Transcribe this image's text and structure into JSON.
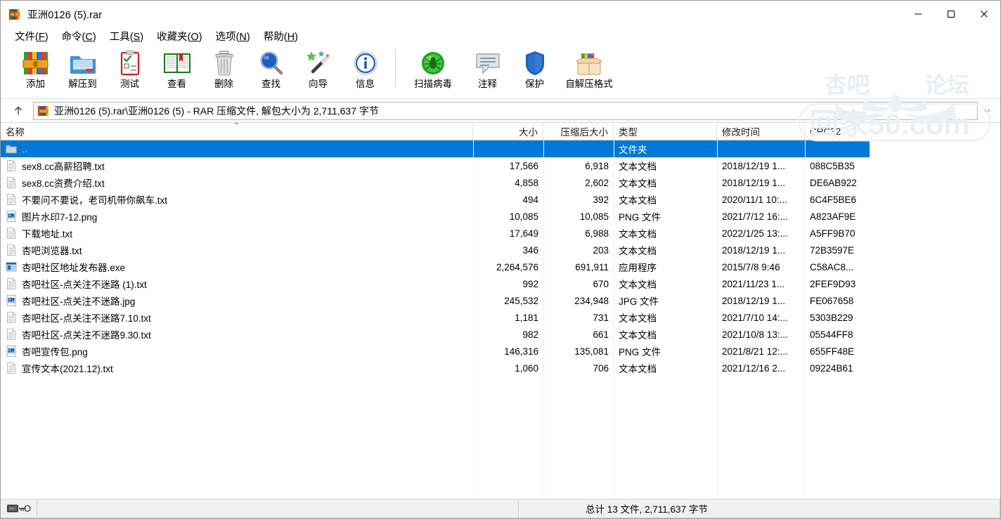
{
  "window": {
    "title": "亚洲0126 (5).rar",
    "icon": "rar-archive-icon",
    "minimize_label": "—",
    "maximize_label": "□",
    "close_label": "✕"
  },
  "menubar": [
    {
      "text": "文件",
      "accel": "F"
    },
    {
      "text": "命令",
      "accel": "C"
    },
    {
      "text": "工具",
      "accel": "S"
    },
    {
      "text": "收藏夹",
      "accel": "O"
    },
    {
      "text": "选项",
      "accel": "N"
    },
    {
      "text": "帮助",
      "accel": "H"
    }
  ],
  "toolbar": {
    "buttons": [
      {
        "label": "添加",
        "icon": "add-archive-icon"
      },
      {
        "label": "解压到",
        "icon": "extract-to-folder-icon"
      },
      {
        "label": "测试",
        "icon": "test-clipboard-icon"
      },
      {
        "label": "查看",
        "icon": "view-book-icon"
      },
      {
        "label": "删除",
        "icon": "delete-trash-icon"
      },
      {
        "label": "查找",
        "icon": "find-magnifier-icon"
      },
      {
        "label": "向导",
        "icon": "wizard-wand-icon"
      },
      {
        "label": "信息",
        "icon": "info-circle-icon"
      }
    ],
    "buttons2": [
      {
        "label": "扫描病毒",
        "icon": "virus-scan-icon"
      },
      {
        "label": "注释",
        "icon": "comment-bubble-icon"
      },
      {
        "label": "保护",
        "icon": "protect-shield-icon"
      },
      {
        "label": "自解压格式",
        "icon": "sfx-box-icon"
      }
    ]
  },
  "watermark": {
    "top_left": "杏吧",
    "top_right": "论坛",
    "bottom": "回家50.com",
    "color": "#eceff1"
  },
  "addressbar": {
    "up_icon": "arrow-up-icon",
    "archive_icon": "rar-archive-icon",
    "path": "亚洲0126 (5).rar\\亚洲0126 (5) - RAR 压缩文件, 解包大小为 2,711,637 字节",
    "dropdown_icon": "chevron-down-icon"
  },
  "columns": [
    {
      "key": "name",
      "label": "名称",
      "align": "left",
      "sorted": true
    },
    {
      "key": "size",
      "label": "大小",
      "align": "right",
      "sorted": false
    },
    {
      "key": "pack",
      "label": "压缩后大小",
      "align": "right",
      "sorted": false
    },
    {
      "key": "type",
      "label": "类型",
      "align": "left",
      "sorted": false
    },
    {
      "key": "date",
      "label": "修改时间",
      "align": "left",
      "sorted": false
    },
    {
      "key": "crc",
      "label": "CRC32",
      "align": "left",
      "sorted": false
    }
  ],
  "rows": [
    {
      "name": "..",
      "icon": "folder-icon",
      "size": "",
      "pack": "",
      "type": "文件夹",
      "date": "",
      "crc": "",
      "selected": true
    },
    {
      "name": "sex8.cc高薪招聘.txt",
      "icon": "text-file-icon",
      "size": "17,566",
      "pack": "6,918",
      "type": "文本文档",
      "date": "2018/12/19 1...",
      "crc": "088C5B35",
      "selected": false
    },
    {
      "name": "sex8.cc资费介绍.txt",
      "icon": "text-file-icon",
      "size": "4,858",
      "pack": "2,602",
      "type": "文本文档",
      "date": "2018/12/19 1...",
      "crc": "DE6AB922",
      "selected": false
    },
    {
      "name": "不要问不要说，老司机带你飙车.txt",
      "icon": "text-file-icon",
      "size": "494",
      "pack": "392",
      "type": "文本文档",
      "date": "2020/11/1 10:...",
      "crc": "6C4F5BE6",
      "selected": false
    },
    {
      "name": "图片水印7-12.png",
      "icon": "image-file-icon",
      "size": "10,085",
      "pack": "10,085",
      "type": "PNG 文件",
      "date": "2021/7/12 16:...",
      "crc": "A823AF9E",
      "selected": false
    },
    {
      "name": "下载地址.txt",
      "icon": "text-file-icon",
      "size": "17,649",
      "pack": "6,988",
      "type": "文本文档",
      "date": "2022/1/25 13:...",
      "crc": "A5FF9B70",
      "selected": false
    },
    {
      "name": "杏吧浏览器.txt",
      "icon": "text-file-icon",
      "size": "346",
      "pack": "203",
      "type": "文本文档",
      "date": "2018/12/19 1...",
      "crc": "72B3597E",
      "selected": false
    },
    {
      "name": "杏吧社区地址发布器.exe",
      "icon": "exe-file-icon",
      "size": "2,264,576",
      "pack": "691,911",
      "type": "应用程序",
      "date": "2015/7/8 9:46",
      "crc": "C58AC8...",
      "selected": false
    },
    {
      "name": "杏吧社区-点关注不迷路 (1).txt",
      "icon": "text-file-icon",
      "size": "992",
      "pack": "670",
      "type": "文本文档",
      "date": "2021/11/23 1...",
      "crc": "2FEF9D93",
      "selected": false
    },
    {
      "name": "杏吧社区-点关注不迷路.jpg",
      "icon": "image-file-icon",
      "size": "245,532",
      "pack": "234,948",
      "type": "JPG 文件",
      "date": "2018/12/19 1...",
      "crc": "FE067658",
      "selected": false
    },
    {
      "name": "杏吧社区-点关注不迷路7.10.txt",
      "icon": "text-file-icon",
      "size": "1,181",
      "pack": "731",
      "type": "文本文档",
      "date": "2021/7/10 14:...",
      "crc": "5303B229",
      "selected": false
    },
    {
      "name": "杏吧社区-点关注不迷路9.30.txt",
      "icon": "text-file-icon",
      "size": "982",
      "pack": "661",
      "type": "文本文档",
      "date": "2021/10/8 13:...",
      "crc": "05544FF8",
      "selected": false
    },
    {
      "name": "杏吧宣传包.png",
      "icon": "image-file-icon",
      "size": "146,316",
      "pack": "135,081",
      "type": "PNG 文件",
      "date": "2021/8/21 12:...",
      "crc": "655FF48E",
      "selected": false
    },
    {
      "name": "宣传文本(2021.12).txt",
      "icon": "text-file-icon",
      "size": "1,060",
      "pack": "706",
      "type": "文本文档",
      "date": "2021/12/16 2...",
      "crc": "09224B61",
      "selected": false
    }
  ],
  "statusbar": {
    "left_icon": "disk-key-icon",
    "total_text": "总计 13 文件, 2,711,637 字节"
  },
  "colors": {
    "selection": "#0078d7",
    "window_bg": "#ffffff",
    "status_bg": "#f0f0f0"
  }
}
